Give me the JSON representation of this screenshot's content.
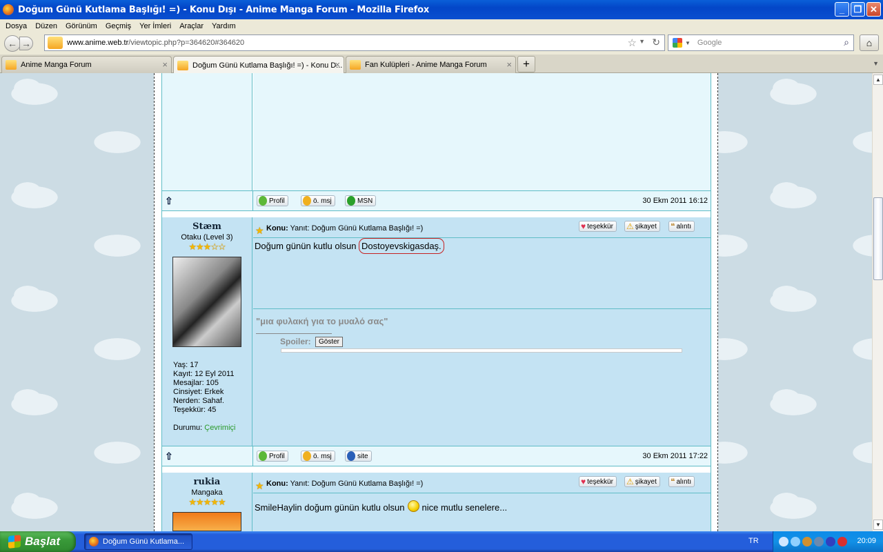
{
  "window": {
    "title": "Doğum Günü Kutlama Başlığı! =) - Konu Dışı - Anime Manga Forum - Mozilla Firefox"
  },
  "menu": [
    "Dosya",
    "Düzen",
    "Görünüm",
    "Geçmiş",
    "Yer İmleri",
    "Araçlar",
    "Yardım"
  ],
  "url": {
    "host": "www.anime.web.tr",
    "path": "/viewtopic.php?p=364620#364620"
  },
  "search": {
    "placeholder": "Google"
  },
  "tabs": [
    {
      "label": "Anime Manga Forum"
    },
    {
      "label": "Doğum Günü Kutlama Başlığı! =) - Konu D..."
    },
    {
      "label": "Fan Kulüpleri - Anime Manga Forum"
    }
  ],
  "icons": {
    "home": "home-icon",
    "star": "bookmark-star-icon",
    "reload": "reload-icon",
    "search": "magnifier-icon"
  },
  "post1_footer": {
    "buttons": [
      "Profil",
      "ö. msj",
      "MSN"
    ],
    "date": "30 Ekm 2011 16:12"
  },
  "post2": {
    "username": "Stæm",
    "rank": "Otaku (Level 3)",
    "stars": "★★★☆☆",
    "info": [
      "Yaş: 17",
      "Kayıt: 12 Eyl 2011",
      "Mesajlar: 105",
      "Cinsiyet: Erkek",
      "Nerden: Sahaf.",
      "Teşekkür: 45"
    ],
    "status_label": "Durumu:",
    "status_value": "Çevrimiçi",
    "subject_label": "Konu:",
    "subject": "Yanıt: Doğum Günü Kutlama Başlığı! =)",
    "actions": [
      "teşekkür",
      "şikayet",
      "alıntı"
    ],
    "body_prefix": "Doğum günün kutlu olsun ",
    "body_highlight": "Dostoyevskigasdaş.",
    "sig_quote": "\"μια φυλακή για το μυαλό σας\"",
    "spoiler_label": "Spoiler:",
    "spoiler_button": "Göster"
  },
  "post2_footer": {
    "buttons": [
      "Profil",
      "ö. msj",
      "site"
    ],
    "date": "30 Ekm 2011 17:22"
  },
  "post3": {
    "username": "rukia",
    "rank": "Mangaka",
    "stars": "★★★★★",
    "subject_label": "Konu:",
    "subject": "Yanıt: Doğum Günü Kutlama Başlığı! =)",
    "actions": [
      "teşekkür",
      "şikayet",
      "alıntı"
    ],
    "body_prefix": "SmileHaylin doğum günün kutlu olsun",
    "body_suffix": "nice mutlu senelere..."
  },
  "taskbar": {
    "start": "Başlat",
    "task": "Doğum Günü Kutlama...",
    "lang": "TR",
    "clock": "20:09"
  }
}
